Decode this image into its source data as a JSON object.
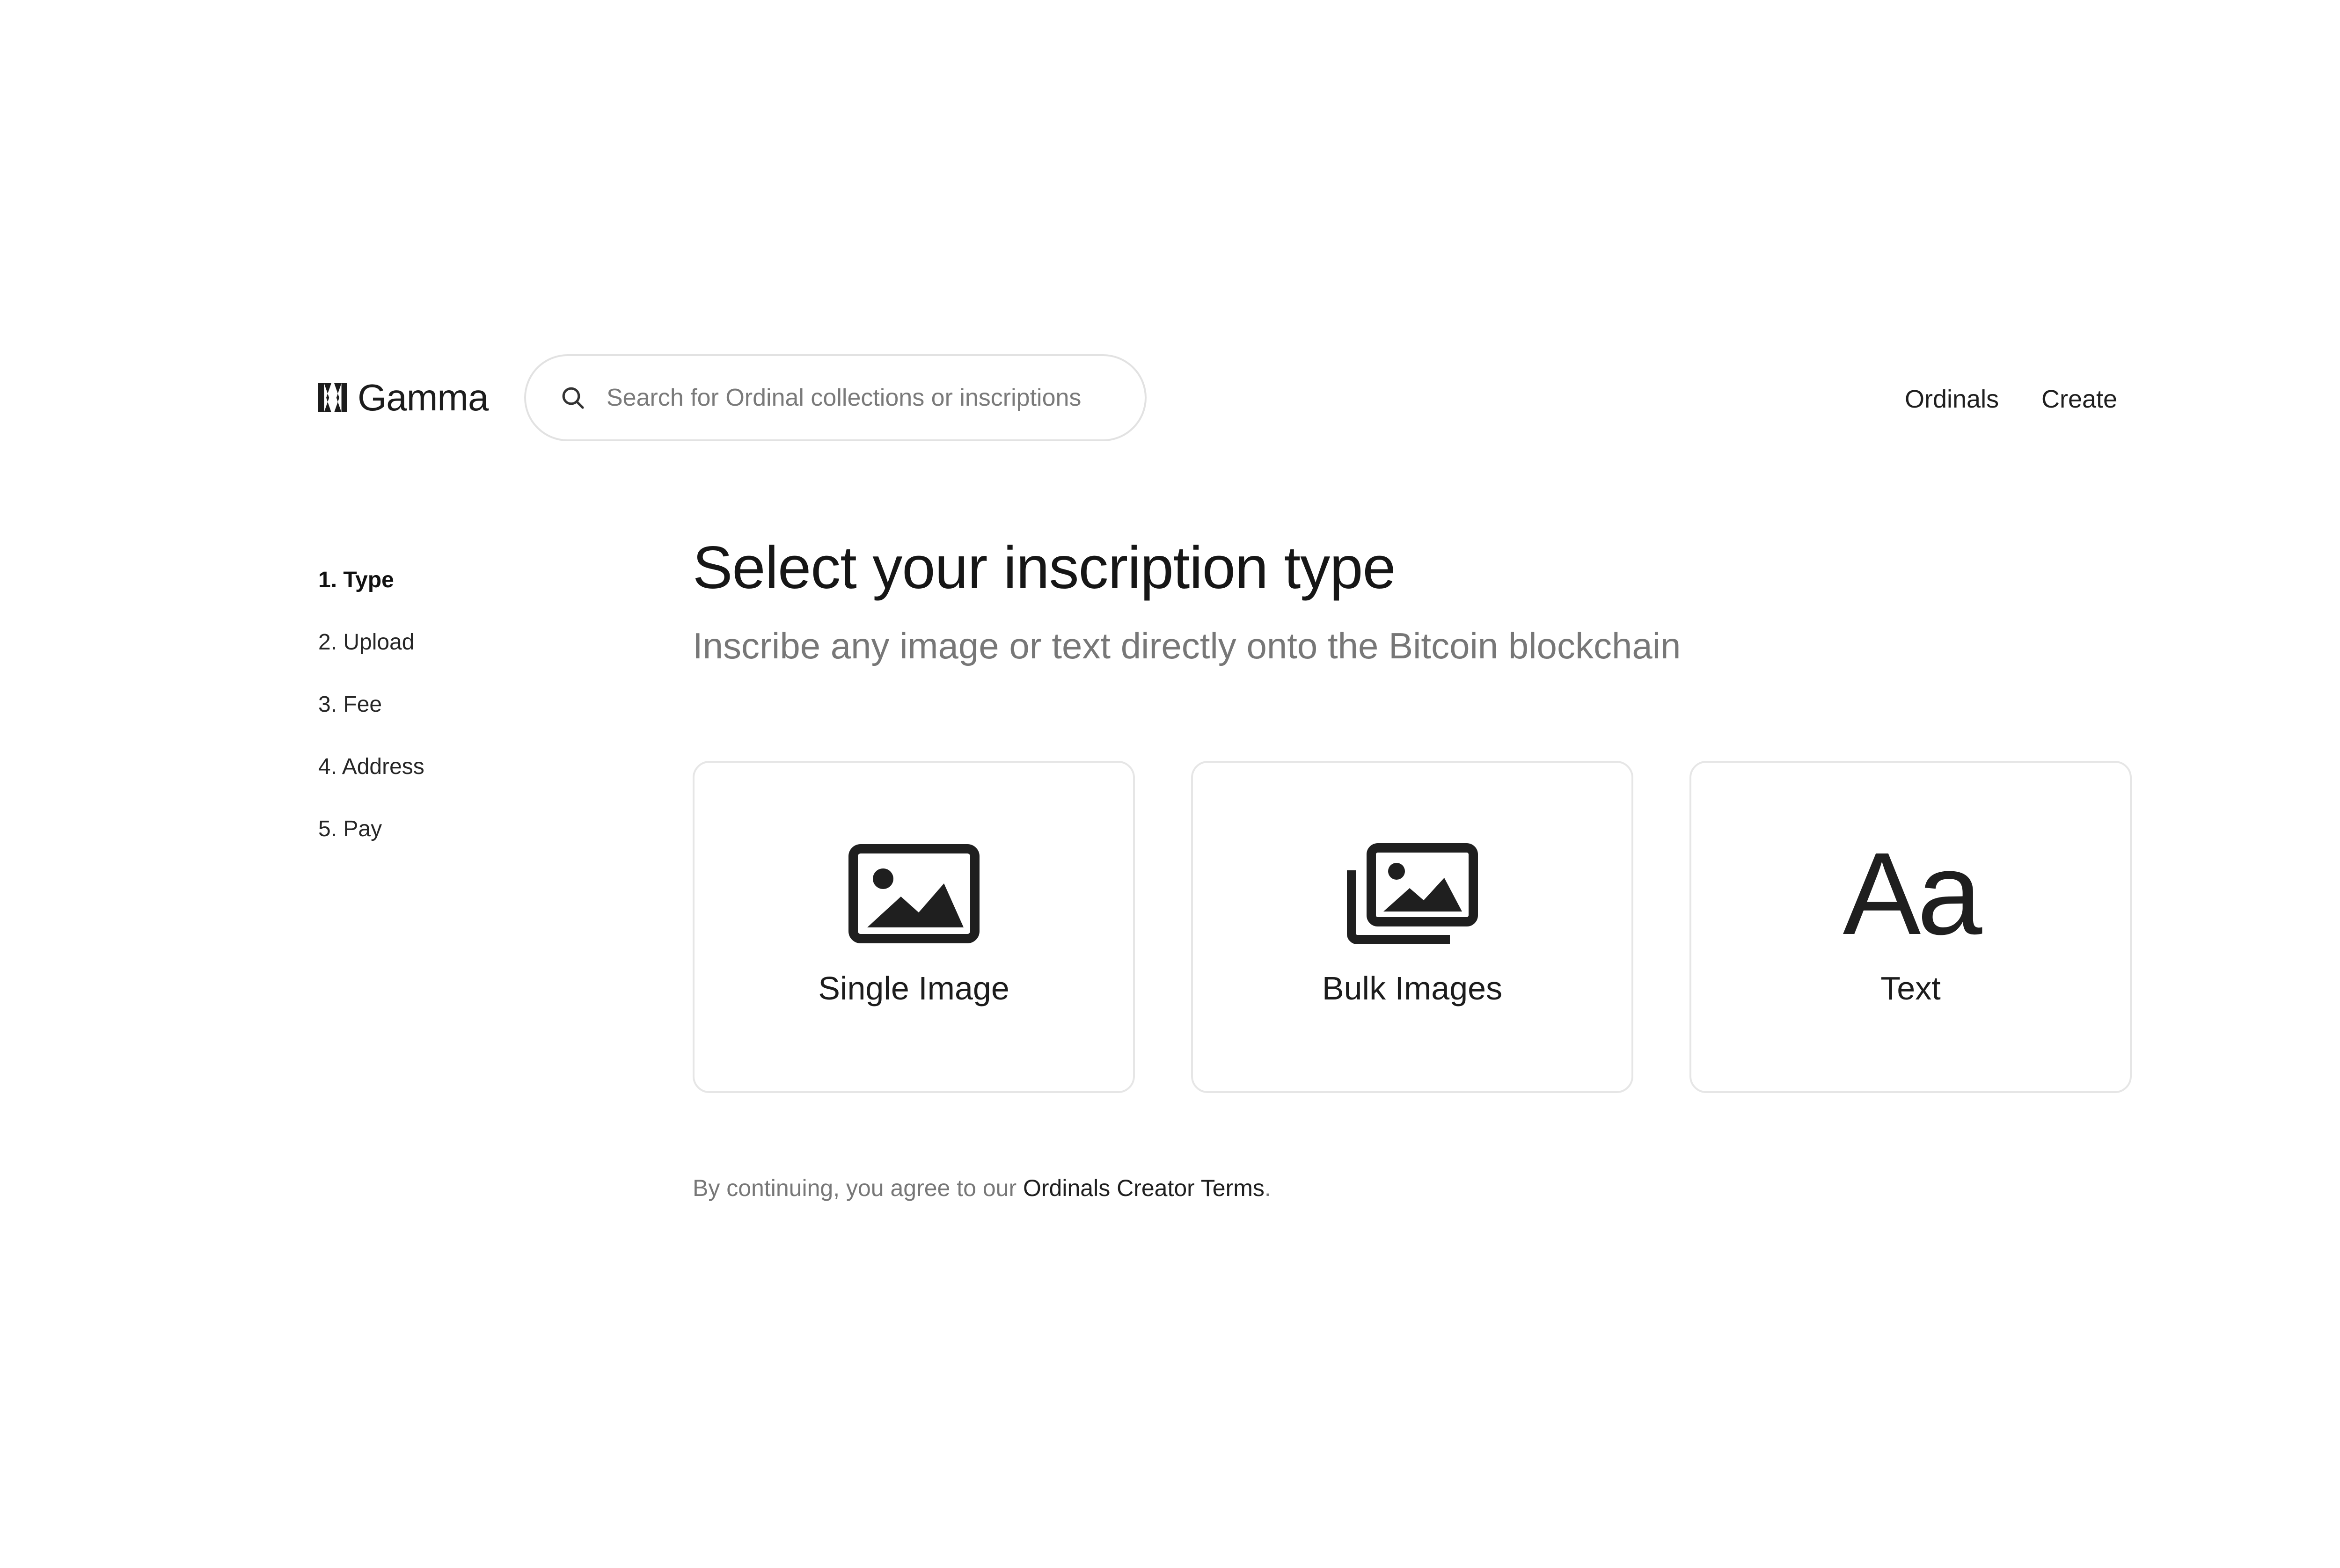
{
  "header": {
    "logo_text": "Gamma",
    "search": {
      "placeholder": "Search for Ordinal collections or inscriptions"
    },
    "nav": {
      "ordinals": "Ordinals",
      "create": "Create"
    }
  },
  "steps": [
    {
      "label": "1. Type",
      "active": true
    },
    {
      "label": "2. Upload"
    },
    {
      "label": "3. Fee"
    },
    {
      "label": "4. Address"
    },
    {
      "label": "5. Pay"
    }
  ],
  "main": {
    "title": "Select your inscription type",
    "subtitle": "Inscribe any image or text directly onto the Bitcoin blockchain",
    "cards": [
      {
        "label": "Single Image",
        "icon": "image-icon"
      },
      {
        "label": "Bulk Images",
        "icon": "images-stack-icon"
      },
      {
        "label": "Text",
        "icon": "text-aa-icon",
        "glyph": "Aa"
      }
    ],
    "terms": {
      "prefix": "By continuing, you agree to our ",
      "link": "Ordinals Creator Terms",
      "suffix": "."
    }
  }
}
